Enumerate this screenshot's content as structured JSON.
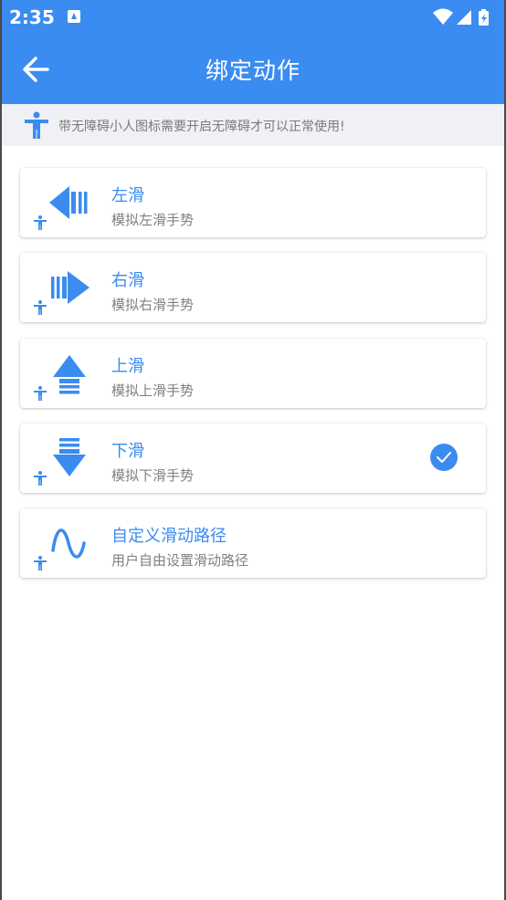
{
  "status_bar": {
    "time": "2:35"
  },
  "header": {
    "title": "绑定动作",
    "back_icon": "arrow-back-icon"
  },
  "notice": {
    "text": "带无障碍小人图标需要开启无障碍才可以正常使用!"
  },
  "actions": [
    {
      "title": "左滑",
      "subtitle": "模拟左滑手势",
      "icon": "swipe-left-icon",
      "selected": false
    },
    {
      "title": "右滑",
      "subtitle": "模拟右滑手势",
      "icon": "swipe-right-icon",
      "selected": false
    },
    {
      "title": "上滑",
      "subtitle": "模拟上滑手势",
      "icon": "swipe-up-icon",
      "selected": false
    },
    {
      "title": "下滑",
      "subtitle": "模拟下滑手势",
      "icon": "swipe-down-icon",
      "selected": true
    },
    {
      "title": "自定义滑动路径",
      "subtitle": "用户自由设置滑动路径",
      "icon": "custom-path-icon",
      "selected": false
    }
  ],
  "colors": {
    "accent": "#3a8cf0",
    "notice_bg": "#f0f1f4",
    "subtitle": "#808080"
  }
}
